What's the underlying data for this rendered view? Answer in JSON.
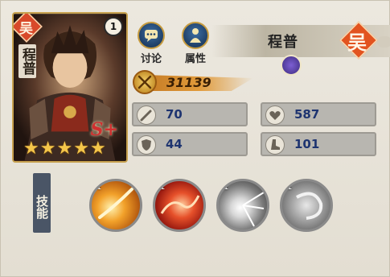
{
  "hero": {
    "name": "程普",
    "name_vertical": "程普",
    "level": "1",
    "star_count": 5,
    "rank_badge": "S+",
    "faction_seal_text": "吴"
  },
  "buttons": {
    "discuss_label": "讨论",
    "attributes_label": "属性"
  },
  "power": {
    "value": "31139"
  },
  "stats": {
    "attack": "70",
    "hp": "587",
    "defense": "44",
    "speed": "101"
  },
  "skills": {
    "section_label": "技能",
    "items": [
      {
        "level": "1",
        "icon": "golden-slash-icon"
      },
      {
        "level": "1",
        "icon": "red-dragon-icon"
      },
      {
        "level": "1",
        "icon": "light-burst-icon"
      },
      {
        "level": "1",
        "icon": "grey-swirl-icon"
      }
    ]
  },
  "colors": {
    "accent_gold": "#c69b3f",
    "faction_red": "#e2531f",
    "stat_text": "#1e3470"
  }
}
